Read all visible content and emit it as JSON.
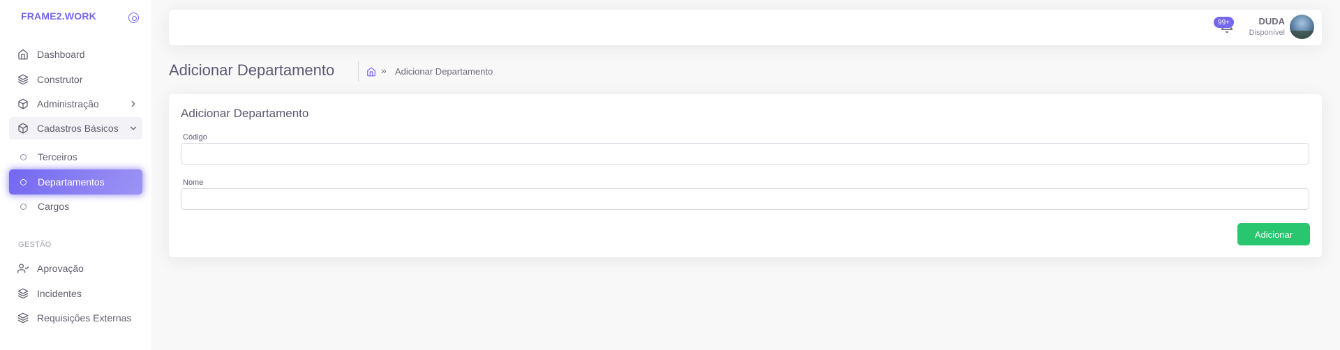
{
  "brand": {
    "name": "FRAME2.WORK"
  },
  "sidebar": {
    "items": [
      {
        "label": "Dashboard",
        "icon": "home-icon"
      },
      {
        "label": "Construtor",
        "icon": "layers-icon"
      },
      {
        "label": "Administração",
        "icon": "package-icon"
      },
      {
        "label": "Cadastros Básicos",
        "icon": "package-icon"
      }
    ],
    "sub_items": [
      {
        "label": "Terceiros"
      },
      {
        "label": "Departamentos"
      },
      {
        "label": "Cargos"
      }
    ],
    "section_header": "GESTÃO",
    "gestao_items": [
      {
        "label": "Aprovação",
        "icon": "user-check-icon"
      },
      {
        "label": "Incidentes",
        "icon": "layers-icon"
      },
      {
        "label": "Requisições Externas",
        "icon": "layers-icon"
      }
    ]
  },
  "navbar": {
    "notification_badge": "99+",
    "user_name": "DUDA",
    "user_status": "Disponível"
  },
  "page": {
    "title": "Adicionar Departamento",
    "breadcrumb_separator": "»",
    "breadcrumb_current": "Adicionar Departamento"
  },
  "form": {
    "card_title": "Adicionar Departamento",
    "codigo_label": "Código",
    "codigo_value": "",
    "nome_label": "Nome",
    "nome_value": "",
    "submit_label": "Adicionar"
  },
  "colors": {
    "primary": "#7367f0",
    "success": "#28c76f",
    "background": "#f8f8f8"
  }
}
